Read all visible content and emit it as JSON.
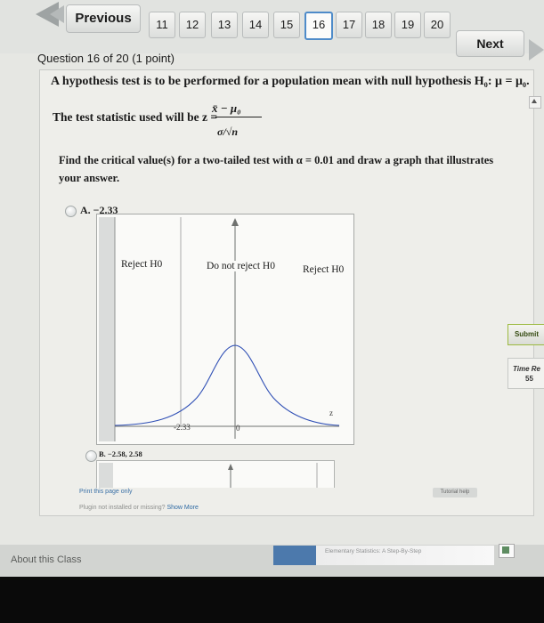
{
  "nav": {
    "previous_label": "Previous",
    "next_label": "Next",
    "pages": [
      "11",
      "12",
      "13",
      "14",
      "15",
      "16",
      "17",
      "18",
      "19",
      "20"
    ],
    "current_page": "16"
  },
  "question": {
    "header": "Question 16 of 20 (1 point)",
    "line1": "A hypothesis test is to be performed for a population mean with null hypothesis H₀: μ = μ₀.",
    "line2": "The test statistic used will be z =",
    "formula_numerator": "x̄ − μ₀",
    "formula_denominator": "σ/√n",
    "line3": "Find the critical value(s) for a two-tailed test with α = 0.01 and draw a graph that illustrates your answer."
  },
  "options": {
    "a_label": "A. −2.33",
    "b_label": "B. −2.58, 2.58"
  },
  "graph": {
    "reject_left": "Reject H0",
    "do_not_reject": "Do not reject H0",
    "reject_right": "Reject H0",
    "critical_tick": "-2.33",
    "zero_tick": "0",
    "axis_end": "z"
  },
  "footer": {
    "print_link": "Print this page only",
    "plugin_text": "Plugin not installed or missing?",
    "show_more": "Show More",
    "tutorial": "Tutorial help"
  },
  "side": {
    "submit_label": "Submit",
    "time_label": "Time Re",
    "time_value": "55"
  },
  "bottom": {
    "about_label": "About this Class",
    "book_title": "Elementary Statistics: A Step-By-Step"
  },
  "colors": {
    "accent": "#4e8bc9",
    "submit_border": "#9cba3f",
    "link": "#2f6aa3"
  }
}
